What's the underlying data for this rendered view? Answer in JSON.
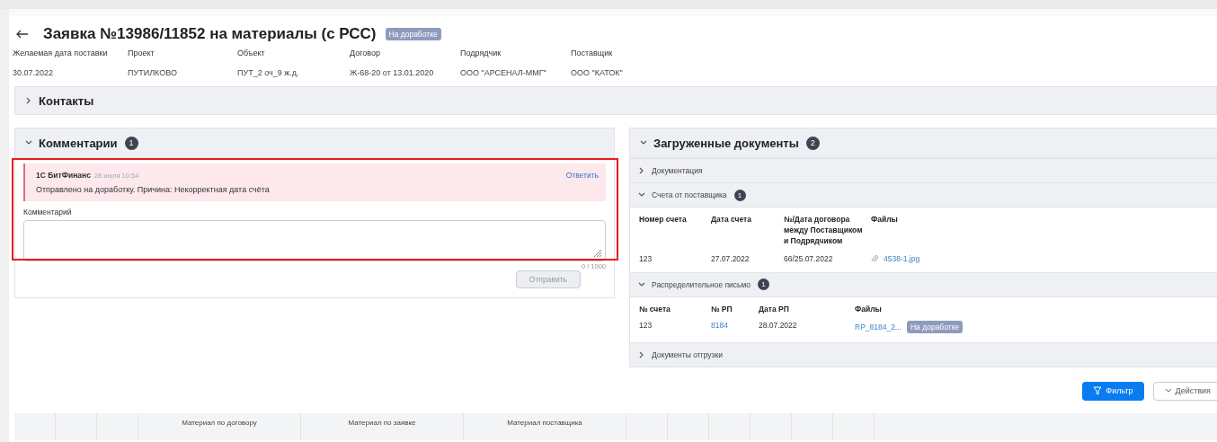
{
  "header": {
    "title": "Заявка №13986/11852 на материалы (с РСС)",
    "status": "На доработке"
  },
  "info": [
    {
      "label": "Желаемая дата поставки",
      "value": "30.07.2022"
    },
    {
      "label": "Проект",
      "value": "ПУТИЛКОВО"
    },
    {
      "label": "Объект",
      "value": "ПУТ_2 оч_9 ж.д."
    },
    {
      "label": "Договор",
      "value": "Ж-68-20 от 13.01.2020"
    },
    {
      "label": "Подрядчик",
      "value": "ООО \"АРСЕНАЛ-ММГ\""
    },
    {
      "label": "Поставщик",
      "value": "ООО \"КАТОК\""
    }
  ],
  "contacts": {
    "title": "Контакты",
    "expanded": false
  },
  "comments": {
    "title": "Комментарии",
    "count": "1",
    "expanded": true,
    "highlighted": true,
    "items": [
      {
        "author": "1С БитФинанс",
        "time": "28 июля 10:54",
        "text": "Отправлено на доработку. Причина: Некорректная дата счёта",
        "reply": "Ответить"
      }
    ],
    "field_label": "Комментарий",
    "counter": "0 / 1000",
    "send": "Отправить",
    "send_disabled": true
  },
  "documents": {
    "title": "Загруженные документы",
    "count": "2",
    "expanded": true,
    "sections": [
      {
        "title": "Документация",
        "expanded": false
      },
      {
        "kind": "invoices",
        "title": "Счета от поставщика",
        "count": "1",
        "expanded": true,
        "columns": [
          "Номер счета",
          "Дата счета",
          "№/Дата договора между Поставщиком и Подрядчиком",
          "Файлы"
        ],
        "rows": [
          {
            "number": "123",
            "date": "27.07.2022",
            "contract": "66/25.07.2022",
            "file": "4538-1.jpg"
          }
        ]
      },
      {
        "kind": "letters",
        "title": "Распределительное письмо",
        "count": "1",
        "expanded": true,
        "columns": [
          "№ счета",
          "№ РП",
          "Дата РП",
          "Файлы"
        ],
        "rows": [
          {
            "number": "123",
            "rp": "8184",
            "date": "28.07.2022",
            "file": "RP_8184_2...",
            "status": "На доработке"
          }
        ]
      },
      {
        "title": "Документы отгрузки",
        "expanded": false
      }
    ]
  },
  "actions": [
    {
      "kind": "primary",
      "label": "Фильтр"
    },
    {
      "kind": "dropdown",
      "label": "Действия"
    }
  ],
  "table": {
    "columns": [
      "",
      "",
      "",
      "Материал по договору",
      "Материал по заявке",
      "Материал поставщика",
      "",
      "",
      "",
      "",
      "",
      ""
    ]
  }
}
